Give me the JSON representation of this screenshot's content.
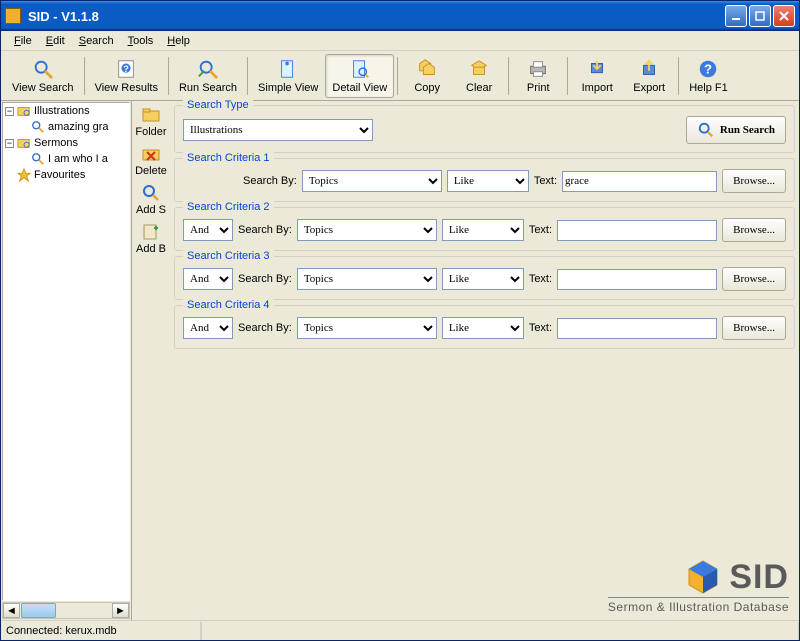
{
  "window": {
    "title": "SID - V1.1.8"
  },
  "menu": {
    "items": [
      "File",
      "Edit",
      "Search",
      "Tools",
      "Help"
    ]
  },
  "toolbar": {
    "view_search": "View Search",
    "view_results": "View Results",
    "run_search": "Run Search",
    "simple_view": "Simple View",
    "detail_view": "Detail View",
    "copy": "Copy",
    "clear": "Clear",
    "print": "Print",
    "import": "Import",
    "export": "Export",
    "help": "Help F1"
  },
  "tree": {
    "illustrations": "Illustrations",
    "illustrations_child": "amazing gra",
    "sermons": "Sermons",
    "sermons_child": "I am who I a",
    "favourites": "Favourites"
  },
  "mini": {
    "folder": "Folder",
    "delete": "Delete",
    "add_s": "Add S",
    "add_b": "Add B"
  },
  "search": {
    "type_title": "Search Type",
    "type_value": "Illustrations",
    "run_label": "Run Search",
    "criteria_titles": [
      "Search Criteria 1",
      "Search Criteria 2",
      "Search Criteria 3",
      "Search Criteria 4"
    ],
    "labels": {
      "search_by": "Search By:",
      "text": "Text:",
      "browse": "Browse..."
    },
    "logic_value": "And",
    "search_by_value": "Topics",
    "match_value": "Like",
    "text_values": [
      "grace",
      "",
      "",
      ""
    ]
  },
  "logo": {
    "text": "SID",
    "subtitle": "Sermon & Illustration Database"
  },
  "status": {
    "connected": "Connected: kerux.mdb"
  }
}
